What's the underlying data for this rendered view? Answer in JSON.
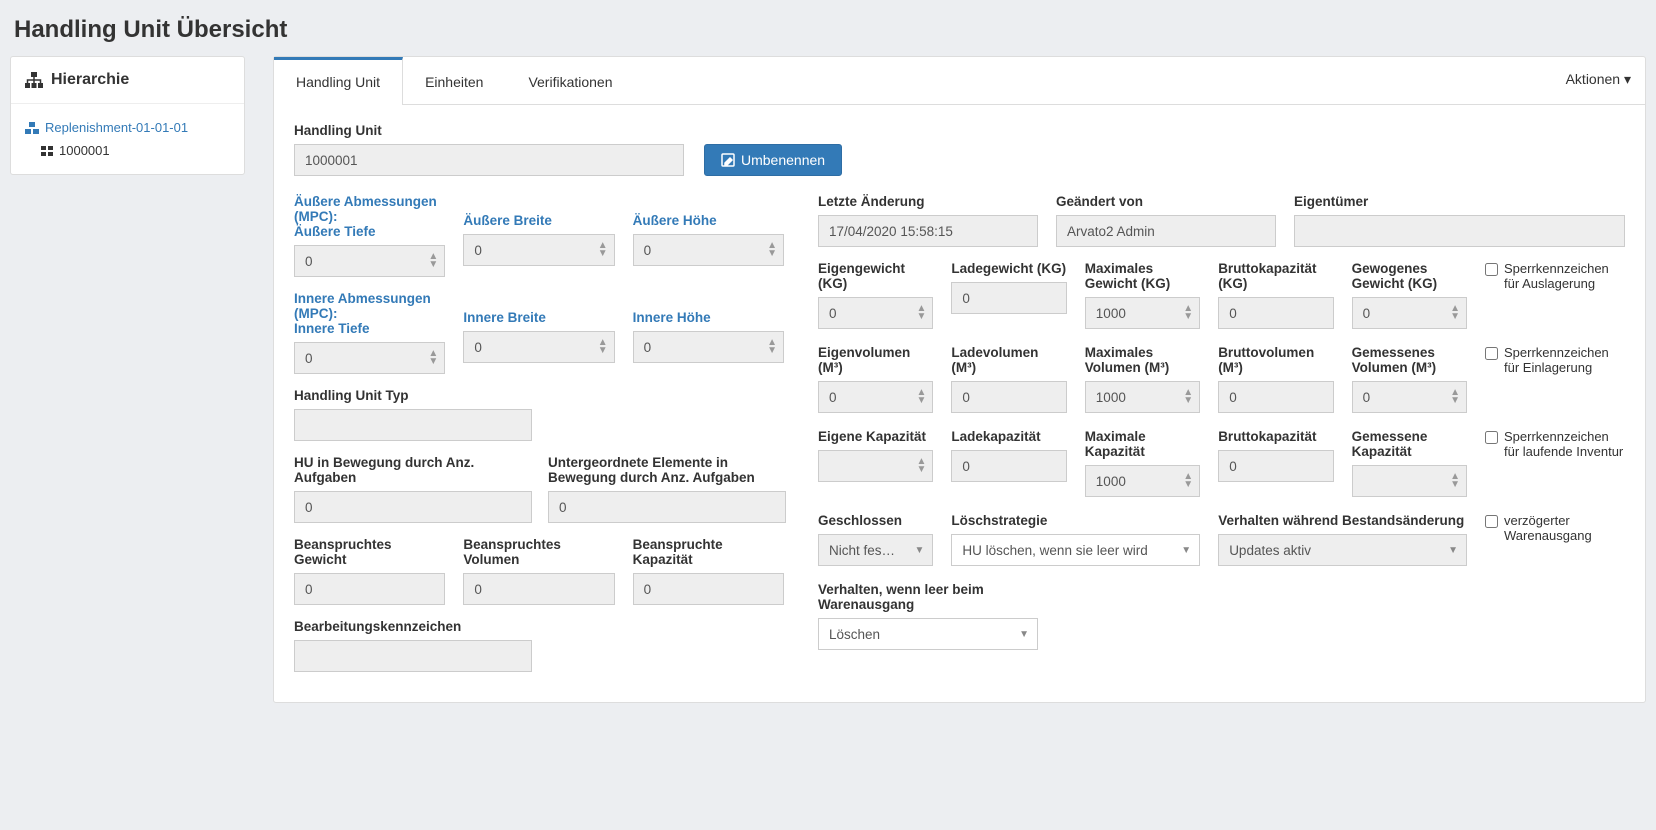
{
  "page_title": "Handling Unit Übersicht",
  "sidebar": {
    "header": "Hierarchie",
    "root": "Replenishment-01-01-01",
    "child": "1000001"
  },
  "tabs": [
    "Handling Unit",
    "Einheiten",
    "Verifikationen"
  ],
  "actions_label": "Aktionen",
  "hu": {
    "label": "Handling Unit",
    "value": "1000001",
    "rename_btn": "Umbenennen"
  },
  "outer_dim": {
    "header": "Äußere Abmessungen (MPC):",
    "depth_l": "Äußere Tiefe",
    "depth_v": "0",
    "width_l": "Äußere Breite",
    "width_v": "0",
    "height_l": "Äußere Höhe",
    "height_v": "0"
  },
  "inner_dim": {
    "header": "Innere Abmessungen (MPC):",
    "depth_l": "Innere Tiefe",
    "depth_v": "0",
    "width_l": "Innere Breite",
    "width_v": "0",
    "height_l": "Innere Höhe",
    "height_v": "0"
  },
  "hu_type_l": "Handling Unit Typ",
  "hu_moving_l": "HU in Bewegung durch Anz. Aufgaben",
  "hu_moving_v": "0",
  "sub_moving_l": "Untergeordnete Elemente in Bewegung durch Anz. Aufgaben",
  "sub_moving_v": "0",
  "claimed_w_l": "Beanspruchtes Gewicht",
  "claimed_w_v": "0",
  "claimed_v_l": "Beanspruchtes Volumen",
  "claimed_v_v": "0",
  "claimed_c_l": "Beanspruchte Kapazität",
  "claimed_c_v": "0",
  "proc_flag_l": "Bearbeitungskennzeichen",
  "last_change_l": "Letzte Änderung",
  "last_change_v": "17/04/2020 15:58:15",
  "changed_by_l": "Geändert von",
  "changed_by_v": "Arvato2 Admin",
  "owner_l": "Eigentümer",
  "w_own_l": "Eigengewicht (KG)",
  "w_own_v": "0",
  "w_load_l": "Ladegewicht (KG)",
  "w_load_v": "0",
  "w_max_l": "Maximales Gewicht (KG)",
  "w_max_v": "1000",
  "w_gross_l": "Bruttokapazität (KG)",
  "w_gross_v": "0",
  "w_meas_l": "Gewogenes Gewicht (KG)",
  "w_meas_v": "0",
  "v_own_l": "Eigenvolumen (M³)",
  "v_own_v": "0",
  "v_load_l": "Ladevolumen (M³)",
  "v_load_v": "0",
  "v_max_l": "Maximales Volumen (M³)",
  "v_max_v": "1000",
  "v_gross_l": "Bruttovolumen (M³)",
  "v_gross_v": "0",
  "v_meas_l": "Gemessenes Volumen (M³)",
  "v_meas_v": "0",
  "c_own_l": "Eigene Kapazität",
  "c_load_l": "Ladekapazität",
  "c_load_v": "0",
  "c_max_l": "Maximale Kapazität",
  "c_max_v": "1000",
  "c_gross_l": "Bruttokapazität",
  "c_gross_v": "0",
  "c_meas_l": "Gemessene Kapazität",
  "closed_l": "Geschlossen",
  "closed_v": "Nicht fes…",
  "del_strat_l": "Löschstrategie",
  "del_strat_v": "HU löschen, wenn sie leer wird",
  "stock_beh_l": "Verhalten während Bestandsänderung",
  "stock_beh_v": "Updates aktiv",
  "empty_beh_l": "Verhalten, wenn leer beim Warenausgang",
  "empty_beh_v": "Löschen",
  "lock_out_l": "Sperrkennzeichen für Auslagerung",
  "lock_in_l": "Sperrkennzeichen für Einlagerung",
  "lock_inv_l": "Sperrkennzeichen für laufende Inventur",
  "delayed_out_l": "verzögerter Warenausgang"
}
